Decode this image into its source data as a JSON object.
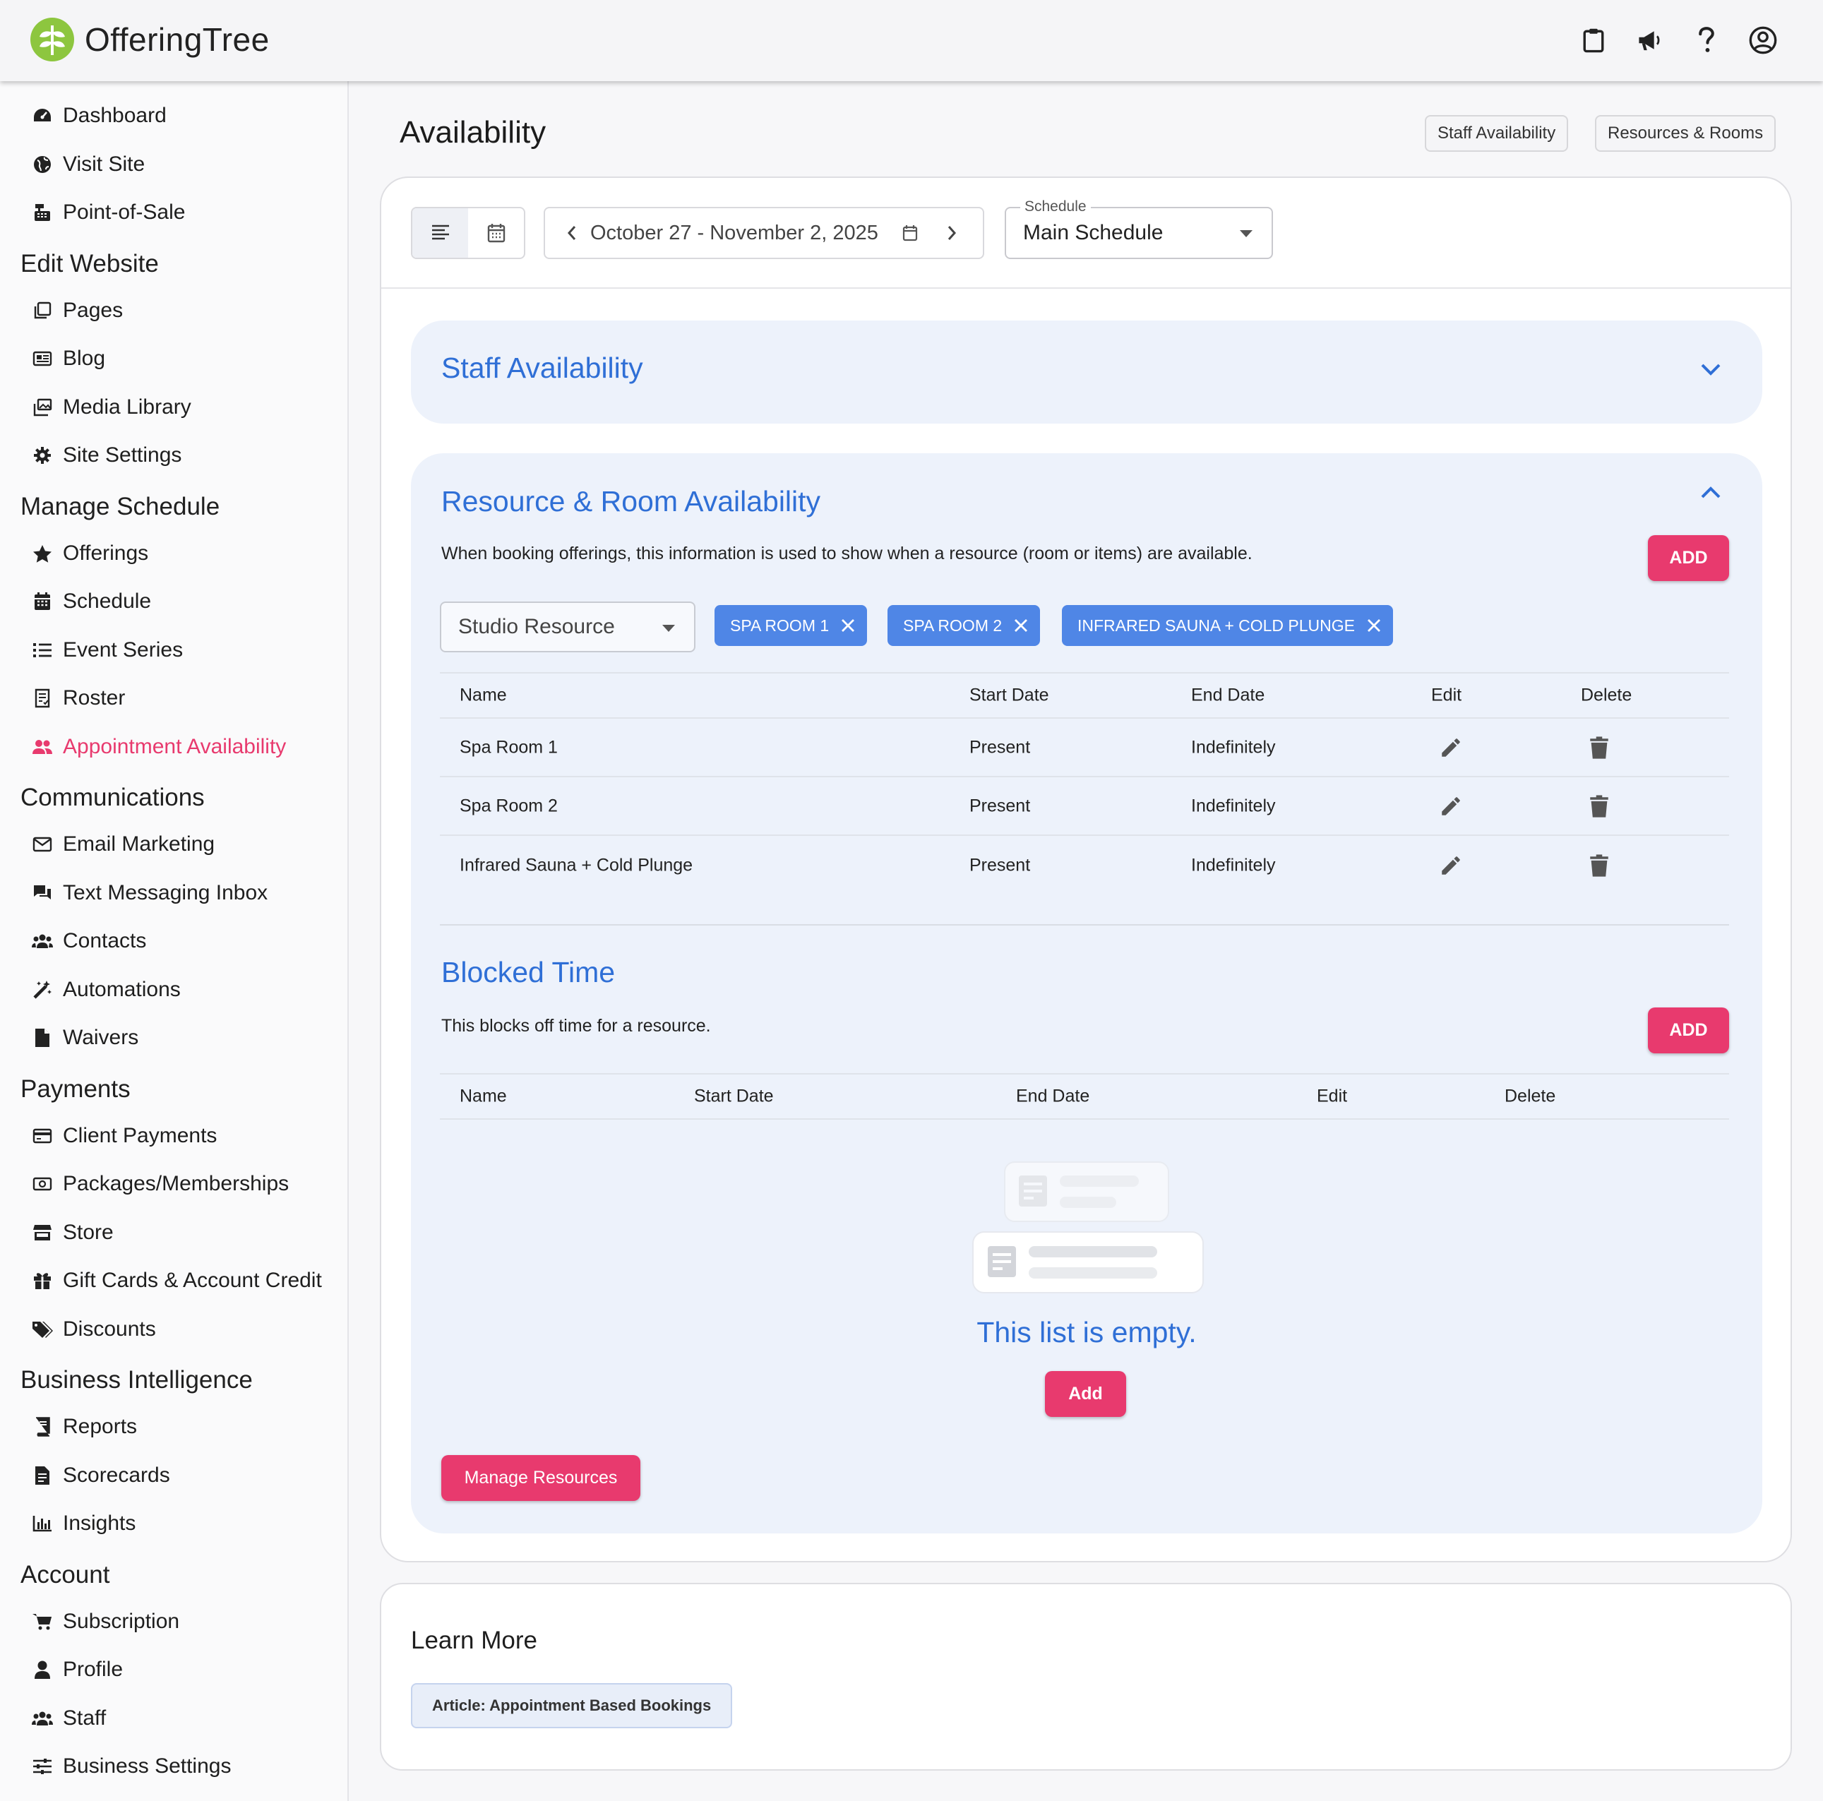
{
  "app": {
    "logo_text": "OfferingTree"
  },
  "header": {
    "icons": [
      "clipboard-icon",
      "megaphone-icon",
      "help-icon",
      "account-icon"
    ]
  },
  "sidebar": {
    "items_top": [
      {
        "label": "Dashboard",
        "icon": "dashboard-icon"
      },
      {
        "label": "Visit Site",
        "icon": "globe-icon"
      },
      {
        "label": "Point-of-Sale",
        "icon": "cash-register-icon"
      }
    ],
    "sections": [
      {
        "title": "Edit Website",
        "items": [
          "Pages",
          "Blog",
          "Media Library",
          "Site Settings"
        ]
      },
      {
        "title": "Manage Schedule",
        "items": [
          "Offerings",
          "Schedule",
          "Event Series",
          "Roster",
          "Appointment Availability"
        ]
      },
      {
        "title": "Communications",
        "items": [
          "Email Marketing",
          "Text Messaging Inbox",
          "Contacts",
          "Automations",
          "Waivers"
        ]
      },
      {
        "title": "Payments",
        "items": [
          "Client Payments",
          "Packages/Memberships",
          "Store",
          "Gift Cards & Account Credit",
          "Discounts"
        ]
      },
      {
        "title": "Business Intelligence",
        "items": [
          "Reports",
          "Scorecards",
          "Insights"
        ]
      },
      {
        "title": "Account",
        "items": [
          "Subscription",
          "Profile",
          "Staff",
          "Business Settings"
        ]
      }
    ],
    "active_item": "Appointment Availability",
    "active_color": "#e83a6e"
  },
  "page": {
    "title": "Availability",
    "top_buttons": [
      "Staff Availability",
      "Resources & Rooms"
    ]
  },
  "toolbar": {
    "date_range": "October 27 - November 2, 2025",
    "schedule_label": "Schedule",
    "schedule_value": "Main Schedule"
  },
  "staff_panel": {
    "title": "Staff Availability"
  },
  "resource_panel": {
    "title": "Resource & Room Availability",
    "description": "When booking offerings, this information is used to show when a resource (room or items) are available.",
    "add_label": "ADD",
    "select_value": "Studio Resource",
    "chips": [
      "SPA ROOM 1",
      "SPA ROOM 2",
      "INFRARED SAUNA + COLD PLUNGE"
    ],
    "columns": [
      "Name",
      "Start Date",
      "End Date",
      "Edit",
      "Delete"
    ],
    "rows": [
      {
        "name": "Spa Room 1",
        "start": "Present",
        "end": "Indefinitely"
      },
      {
        "name": "Spa Room 2",
        "start": "Present",
        "end": "Indefinitely"
      },
      {
        "name": "Infrared Sauna + Cold Plunge",
        "start": "Present",
        "end": "Indefinitely"
      }
    ]
  },
  "blocked_time": {
    "title": "Blocked Time",
    "description": "This blocks off time for a resource.",
    "add_label": "ADD",
    "columns": [
      "Name",
      "Start Date",
      "End Date",
      "Edit",
      "Delete"
    ],
    "empty_text": "This list is empty.",
    "empty_add_label": "Add",
    "manage_label": "Manage Resources"
  },
  "learn_more": {
    "title": "Learn More",
    "article_label": "Article: Appointment Based Bookings"
  },
  "colors": {
    "accent": "#e83a6e",
    "link_blue": "#2f6fd6",
    "chip_blue": "#4f86e6",
    "panel_bg": "#edf2fb",
    "logo_green": "#8dc63f"
  }
}
